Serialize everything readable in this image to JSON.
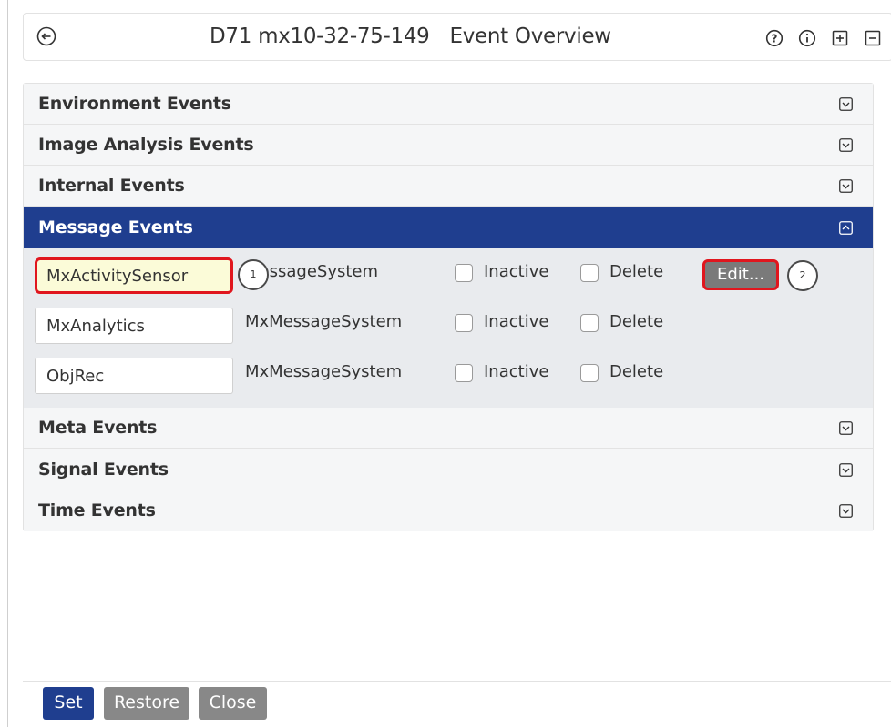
{
  "header": {
    "device": "D71 mx10-32-75-149",
    "title": "Event Overview"
  },
  "icons": {
    "back": "circle-arrow-left-icon",
    "help": "question-circle-icon",
    "info": "info-circle-icon",
    "expand_all": "plus-square-icon",
    "collapse_all": "minus-square-icon"
  },
  "sections": {
    "environment": "Environment Events",
    "image_analysis": "Image Analysis Events",
    "internal": "Internal Events",
    "message": "Message Events",
    "meta": "Meta Events",
    "signal": "Signal Events",
    "time": "Time Events"
  },
  "message_rows": [
    {
      "name": "MxActivitySensor",
      "system": "MessageSystem",
      "inactive_label": "Inactive",
      "delete_label": "Delete",
      "edit_label": "Edit..."
    },
    {
      "name": "MxAnalytics",
      "system": "MxMessageSystem",
      "inactive_label": "Inactive",
      "delete_label": "Delete"
    },
    {
      "name": "ObjRec",
      "system": "MxMessageSystem",
      "inactive_label": "Inactive",
      "delete_label": "Delete"
    }
  ],
  "callouts": {
    "first": "1",
    "second": "2"
  },
  "footer": {
    "set": "Set",
    "restore": "Restore",
    "close": "Close"
  },
  "colors": {
    "accent": "#1f3e8f",
    "highlight_border": "#e0161e",
    "secondary_button": "#888888"
  }
}
